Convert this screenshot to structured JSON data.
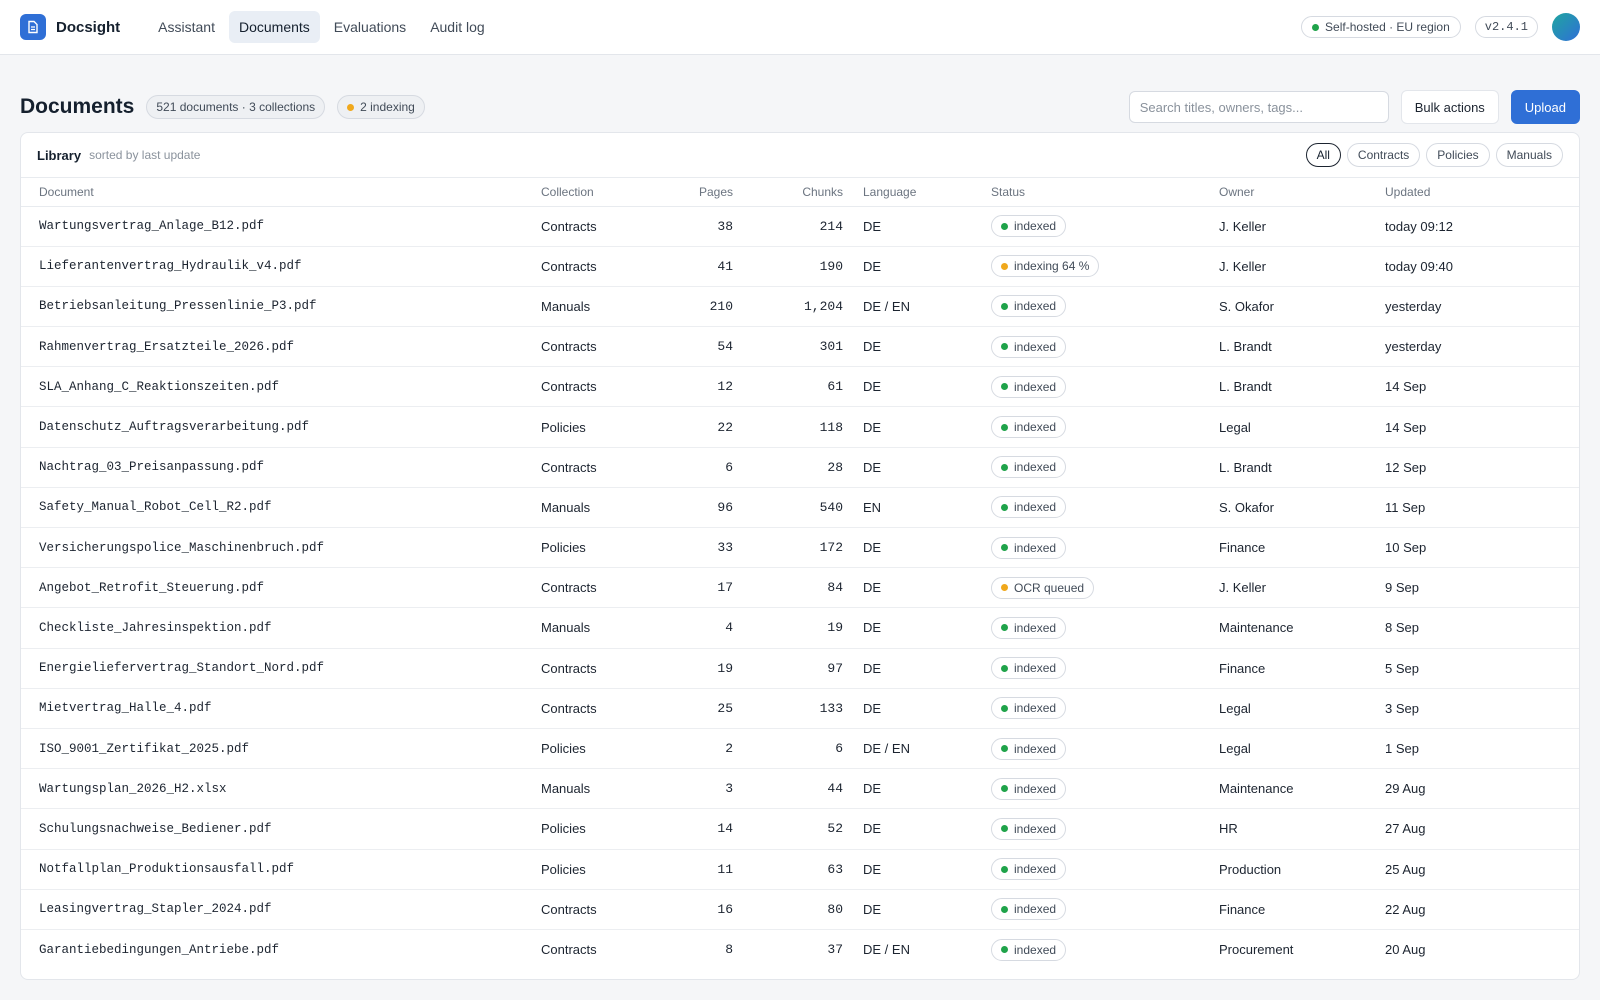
{
  "app": {
    "name": "Docsight",
    "nav": [
      {
        "label": "Assistant",
        "active": false
      },
      {
        "label": "Documents",
        "active": true
      },
      {
        "label": "Evaluations",
        "active": false
      },
      {
        "label": "Audit log",
        "active": false
      }
    ],
    "deployment": "Self-hosted · EU region",
    "version": "v2.4.1",
    "colors": {
      "accent": "#2f6fd6",
      "ok": "#1fa34a",
      "pending": "#f0a81c"
    }
  },
  "page": {
    "title": "Documents",
    "summary": "521 documents · 3 collections",
    "indexing": "2 indexing",
    "search_placeholder": "Search titles, owners, tags...",
    "bulk_label": "Bulk actions",
    "upload_label": "Upload"
  },
  "library": {
    "title": "Library",
    "subtitle": "sorted by last update",
    "filters": [
      "All",
      "Contracts",
      "Policies",
      "Manuals"
    ],
    "active_filter": "All",
    "columns": [
      "Document",
      "Collection",
      "Pages",
      "Chunks",
      "Language",
      "Status",
      "Owner",
      "Updated"
    ],
    "rows": [
      {
        "doc": "Wartungsvertrag_Anlage_B12.pdf",
        "collection": "Contracts",
        "pages": "38",
        "chunks": "214",
        "lang": "DE",
        "status": "indexed",
        "state": "ok",
        "owner": "J. Keller",
        "updated": "today 09:12"
      },
      {
        "doc": "Lieferantenvertrag_Hydraulik_v4.pdf",
        "collection": "Contracts",
        "pages": "41",
        "chunks": "190",
        "lang": "DE",
        "status": "indexing 64 %",
        "state": "pending",
        "owner": "J. Keller",
        "updated": "today 09:40"
      },
      {
        "doc": "Betriebsanleitung_Pressenlinie_P3.pdf",
        "collection": "Manuals",
        "pages": "210",
        "chunks": "1,204",
        "lang": "DE / EN",
        "status": "indexed",
        "state": "ok",
        "owner": "S. Okafor",
        "updated": "yesterday"
      },
      {
        "doc": "Rahmenvertrag_Ersatzteile_2026.pdf",
        "collection": "Contracts",
        "pages": "54",
        "chunks": "301",
        "lang": "DE",
        "status": "indexed",
        "state": "ok",
        "owner": "L. Brandt",
        "updated": "yesterday"
      },
      {
        "doc": "SLA_Anhang_C_Reaktionszeiten.pdf",
        "collection": "Contracts",
        "pages": "12",
        "chunks": "61",
        "lang": "DE",
        "status": "indexed",
        "state": "ok",
        "owner": "L. Brandt",
        "updated": "14 Sep"
      },
      {
        "doc": "Datenschutz_Auftragsverarbeitung.pdf",
        "collection": "Policies",
        "pages": "22",
        "chunks": "118",
        "lang": "DE",
        "status": "indexed",
        "state": "ok",
        "owner": "Legal",
        "updated": "14 Sep"
      },
      {
        "doc": "Nachtrag_03_Preisanpassung.pdf",
        "collection": "Contracts",
        "pages": "6",
        "chunks": "28",
        "lang": "DE",
        "status": "indexed",
        "state": "ok",
        "owner": "L. Brandt",
        "updated": "12 Sep"
      },
      {
        "doc": "Safety_Manual_Robot_Cell_R2.pdf",
        "collection": "Manuals",
        "pages": "96",
        "chunks": "540",
        "lang": "EN",
        "status": "indexed",
        "state": "ok",
        "owner": "S. Okafor",
        "updated": "11 Sep"
      },
      {
        "doc": "Versicherungspolice_Maschinenbruch.pdf",
        "collection": "Policies",
        "pages": "33",
        "chunks": "172",
        "lang": "DE",
        "status": "indexed",
        "state": "ok",
        "owner": "Finance",
        "updated": "10 Sep"
      },
      {
        "doc": "Angebot_Retrofit_Steuerung.pdf",
        "collection": "Contracts",
        "pages": "17",
        "chunks": "84",
        "lang": "DE",
        "status": "OCR queued",
        "state": "pending",
        "owner": "J. Keller",
        "updated": "9 Sep"
      },
      {
        "doc": "Checkliste_Jahresinspektion.pdf",
        "collection": "Manuals",
        "pages": "4",
        "chunks": "19",
        "lang": "DE",
        "status": "indexed",
        "state": "ok",
        "owner": "Maintenance",
        "updated": "8 Sep"
      },
      {
        "doc": "Energieliefervertrag_Standort_Nord.pdf",
        "collection": "Contracts",
        "pages": "19",
        "chunks": "97",
        "lang": "DE",
        "status": "indexed",
        "state": "ok",
        "owner": "Finance",
        "updated": "5 Sep"
      },
      {
        "doc": "Mietvertrag_Halle_4.pdf",
        "collection": "Contracts",
        "pages": "25",
        "chunks": "133",
        "lang": "DE",
        "status": "indexed",
        "state": "ok",
        "owner": "Legal",
        "updated": "3 Sep"
      },
      {
        "doc": "ISO_9001_Zertifikat_2025.pdf",
        "collection": "Policies",
        "pages": "2",
        "chunks": "6",
        "lang": "DE / EN",
        "status": "indexed",
        "state": "ok",
        "owner": "Legal",
        "updated": "1 Sep"
      },
      {
        "doc": "Wartungsplan_2026_H2.xlsx",
        "collection": "Manuals",
        "pages": "3",
        "chunks": "44",
        "lang": "DE",
        "status": "indexed",
        "state": "ok",
        "owner": "Maintenance",
        "updated": "29 Aug"
      },
      {
        "doc": "Schulungsnachweise_Bediener.pdf",
        "collection": "Policies",
        "pages": "14",
        "chunks": "52",
        "lang": "DE",
        "status": "indexed",
        "state": "ok",
        "owner": "HR",
        "updated": "27 Aug"
      },
      {
        "doc": "Notfallplan_Produktionsausfall.pdf",
        "collection": "Policies",
        "pages": "11",
        "chunks": "63",
        "lang": "DE",
        "status": "indexed",
        "state": "ok",
        "owner": "Production",
        "updated": "25 Aug"
      },
      {
        "doc": "Leasingvertrag_Stapler_2024.pdf",
        "collection": "Contracts",
        "pages": "16",
        "chunks": "80",
        "lang": "DE",
        "status": "indexed",
        "state": "ok",
        "owner": "Finance",
        "updated": "22 Aug"
      },
      {
        "doc": "Garantiebedingungen_Antriebe.pdf",
        "collection": "Contracts",
        "pages": "8",
        "chunks": "37",
        "lang": "DE / EN",
        "status": "indexed",
        "state": "ok",
        "owner": "Procurement",
        "updated": "20 Aug"
      }
    ]
  }
}
